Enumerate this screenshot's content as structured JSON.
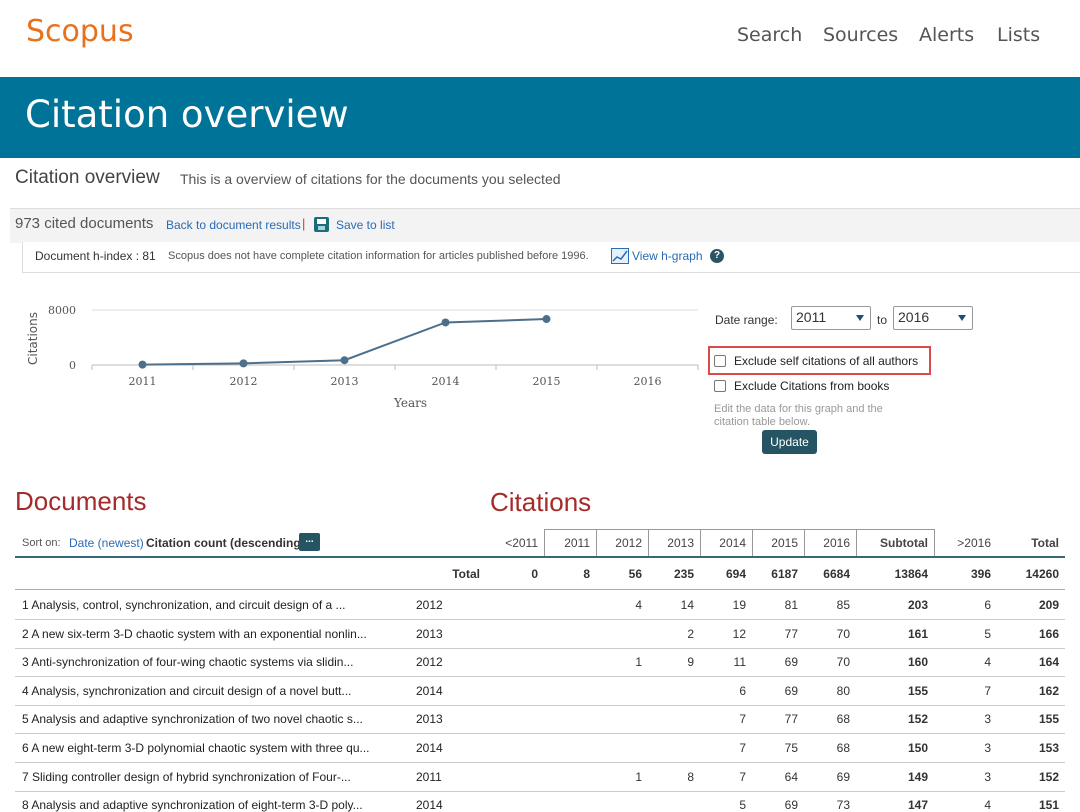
{
  "header": {
    "logo": "Scopus",
    "nav": [
      "Search",
      "Sources",
      "Alerts",
      "Lists"
    ]
  },
  "banner": {
    "title": "Citation overview"
  },
  "subheader": {
    "title": "Citation overview",
    "description": "This is a overview of citations for the documents you selected"
  },
  "toolbar": {
    "cited_count": "973 cited documents",
    "back_link": "Back to document results",
    "separator": "|",
    "save_link": "Save to list"
  },
  "hindex": {
    "label": "Document h-index : 81",
    "note": "Scopus does not have complete citation information for articles published before 1996.",
    "graph_link": "View h-graph",
    "help": "?"
  },
  "chart_data": {
    "type": "line",
    "x": [
      "2011",
      "2012",
      "2013",
      "2014",
      "2015",
      "2016"
    ],
    "series": [
      {
        "values": [
          56,
          235,
          694,
          6187,
          6684
        ]
      }
    ],
    "xlabel": "Years",
    "ylabel": "Citations",
    "yticks": [
      "0",
      "8000"
    ],
    "ylim": [
      0,
      8000
    ],
    "note": ""
  },
  "date_range": {
    "label": "Date range:",
    "from": "2011",
    "to_label": "to",
    "to": "2016",
    "exclude_self": "Exclude self citations of all authors",
    "exclude_books": "Exclude Citations from books",
    "edit_note": "Edit the data for this graph and the citation table below.",
    "update_button": "Update"
  },
  "sections": {
    "documents": "Documents",
    "citations": "Citations"
  },
  "sort": {
    "label": "Sort on:",
    "date": "Date (newest)",
    "count": "Citation count (descending)",
    "more": "..."
  },
  "table": {
    "columns": [
      "<2011",
      "2011",
      "2012",
      "2013",
      "2014",
      "2015",
      "2016",
      "Subtotal",
      ">2016",
      "Total"
    ],
    "total_row": {
      "label": "Total",
      "values": [
        "0",
        "8",
        "56",
        "235",
        "694",
        "6187",
        "6684",
        "13864",
        "396",
        "14260"
      ]
    },
    "rows": [
      {
        "title": "1 Analysis, control, synchronization, and circuit design of a ...",
        "year": "2012",
        "values": [
          "",
          "",
          "4",
          "14",
          "19",
          "81",
          "85",
          "203",
          "6",
          "209"
        ]
      },
      {
        "title": "2 A new six-term 3-D chaotic system with an exponential nonlin...",
        "year": "2013",
        "values": [
          "",
          "",
          "",
          "2",
          "12",
          "77",
          "70",
          "161",
          "5",
          "166"
        ]
      },
      {
        "title": "3 Anti-synchronization of four-wing chaotic systems via slidin...",
        "year": "2012",
        "values": [
          "",
          "",
          "1",
          "9",
          "11",
          "69",
          "70",
          "160",
          "4",
          "164"
        ]
      },
      {
        "title": "4 Analysis, synchronization and circuit design of a novel butt...",
        "year": "2014",
        "values": [
          "",
          "",
          "",
          "",
          "6",
          "69",
          "80",
          "155",
          "7",
          "162"
        ]
      },
      {
        "title": "5 Analysis and adaptive synchronization of two novel chaotic s...",
        "year": "2013",
        "values": [
          "",
          "",
          "",
          "",
          "7",
          "77",
          "68",
          "152",
          "3",
          "155"
        ]
      },
      {
        "title": "6 A new eight-term 3-D polynomial chaotic system with three qu...",
        "year": "2014",
        "values": [
          "",
          "",
          "",
          "",
          "7",
          "75",
          "68",
          "150",
          "3",
          "153"
        ]
      },
      {
        "title": "7 Sliding controller design of hybrid synchronization of Four-...",
        "year": "2011",
        "values": [
          "",
          "",
          "1",
          "8",
          "7",
          "64",
          "69",
          "149",
          "3",
          "152"
        ]
      },
      {
        "title": "8 Analysis and adaptive synchronization of eight-term 3-D poly...",
        "year": "2014",
        "values": [
          "",
          "",
          "",
          "",
          "5",
          "69",
          "73",
          "147",
          "4",
          "151"
        ]
      }
    ]
  }
}
